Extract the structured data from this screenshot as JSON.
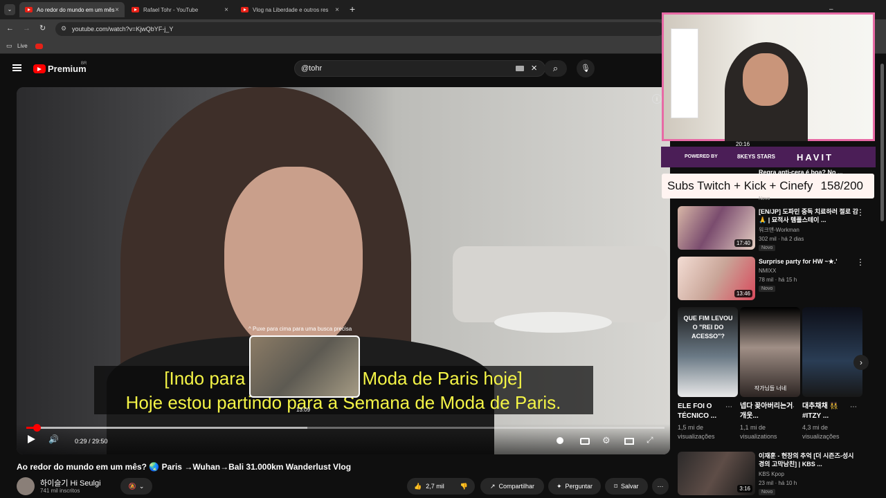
{
  "browser": {
    "tabs": [
      {
        "title": "Ao redor do mundo em um mês",
        "active": true
      },
      {
        "title": "Rafael Tohr - YouTube",
        "active": false
      },
      {
        "title": "Vlog na Liberdade e outros res",
        "active": false
      }
    ],
    "new_tab": "+",
    "address": "youtube.com/watch?v=KjwQbYF-j_Y",
    "bookmarks": [
      {
        "label": "Live"
      }
    ]
  },
  "youtube": {
    "brand": "Premium",
    "region": "BR",
    "search_value": "@tohr"
  },
  "video": {
    "pull_hint": "^ Puxe para cima para uma busca precisa",
    "preview_time": "13:09",
    "subtitle_line1": "[Indo para a Semana de Moda de Paris hoje]",
    "subtitle_line2": "Hoje estou partindo para a Semana de Moda de Paris.",
    "time": "0:29 / 29:50",
    "played_fraction": 0.016,
    "preview_fraction": 0.44
  },
  "watch": {
    "title": "Ao redor do mundo em um mês? 🌏 Paris →Wuhan→Bali 31.000km Wanderlust Vlog",
    "channel": "하이슬기 Hi Seulgi",
    "subscribers": "741 mil inscritos",
    "likes": "2,7 mil",
    "share": "Compartilhar",
    "ask": "Perguntar",
    "save": "Salvar"
  },
  "overlay": {
    "powered_by": "POWERED BY",
    "sponsor_name": "8KEYS STARS",
    "partner": "HAVIT",
    "counter_label": "Subs Twitch + Kick + Cinefy",
    "counter_value": "158/200"
  },
  "sidebar": {
    "partial_top": {
      "duration": "20:16",
      "title": "Regra anti-cera é boa? No ...",
      "badge": "Novo"
    },
    "videos": [
      {
        "title": "[EN/JP] 도파민 중독 치료하러 절로 감 🙏 | 묘적사 템플스테이 ...",
        "channel": "워크맨-Workman",
        "stats": "302 mil · há 2 dias",
        "badge": "Novo",
        "duration": "17:40"
      },
      {
        "title": "Surprise party for HW ~★.'",
        "channel": "NMIXX",
        "stats": "78 mil · há 15 h",
        "badge": "Novo",
        "duration": "13:46"
      }
    ],
    "shorts": [
      {
        "title": "ELE FOI O TÉCNICO ...",
        "views": "1,5 mi de visualizações",
        "overlay": "QUE FIM LEVOU O \"REI DO ACESSO\"?"
      },
      {
        "title": "넵다 꽂아버리는거 개웃...",
        "views": "1,1 mi de visualizations",
        "overlay": "작가님들 너네"
      },
      {
        "title": "대추채채 👯 #ITZY ...",
        "views": "4,3 mi de visualizações",
        "overlay": ""
      }
    ],
    "bottom": {
      "title": "이재훈 - 현장의 추억 [더 시즌즈-성시경의 고막남친] | KBS ...",
      "channel": "KBS Kpop",
      "stats": "23 mil · há 10 h",
      "badge": "Novo",
      "duration": "3:16"
    }
  }
}
